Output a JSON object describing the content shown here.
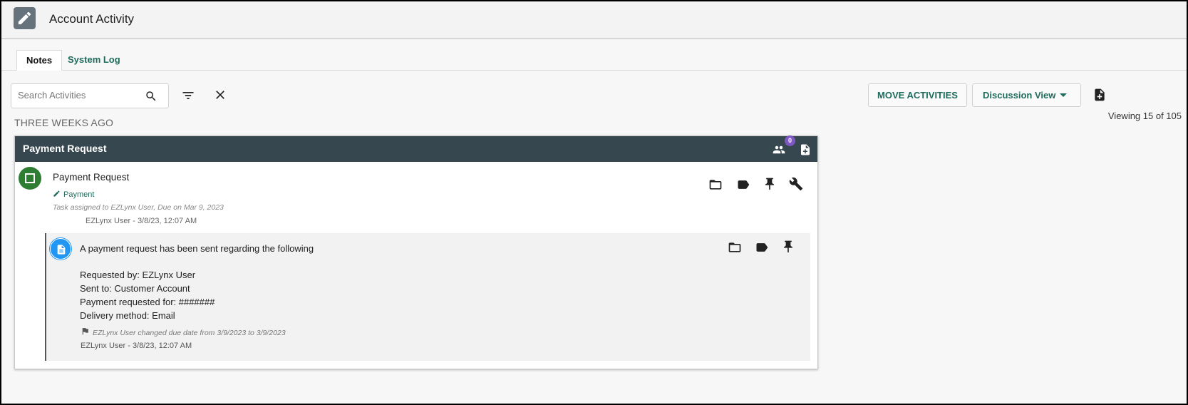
{
  "header": {
    "title": "Account Activity",
    "app_icon": "clipboard-edit-icon"
  },
  "tabs": [
    {
      "label": "Notes",
      "active": true
    },
    {
      "label": "System Log",
      "active": false
    }
  ],
  "toolbar": {
    "search_placeholder": "Search Activities",
    "search_value": "",
    "move_label": "MOVE ACTIVITIES",
    "view_label": "Discussion View",
    "viewing_text": "Viewing 15 of 105"
  },
  "section_label": "THREE WEEKS AGO",
  "card": {
    "title": "Payment Request",
    "participants_count": "0",
    "task": {
      "title": "Payment Request",
      "tag": "Payment",
      "assigned": "Task assigned to EZLynx User, Due on Mar 9, 2023",
      "meta": "EZLynx User - 3/8/23, 12:07 AM"
    },
    "note": {
      "headline": "A payment request has been sent regarding the following",
      "lines": [
        "Requested by: EZLynx User",
        "Sent to: Customer Account",
        "Payment requested for:  #######",
        "Delivery method: Email"
      ],
      "flag_text": "EZLynx User changed due date from 3/9/2023 to 3/9/2023",
      "meta": "EZLynx User - 3/8/23, 12:07 AM"
    }
  },
  "colors": {
    "accent": "#1e6b5c",
    "card_header": "#37474f",
    "task_status": "#2e7d32",
    "note_icon": "#2196f3",
    "badge": "#7e57c2"
  }
}
